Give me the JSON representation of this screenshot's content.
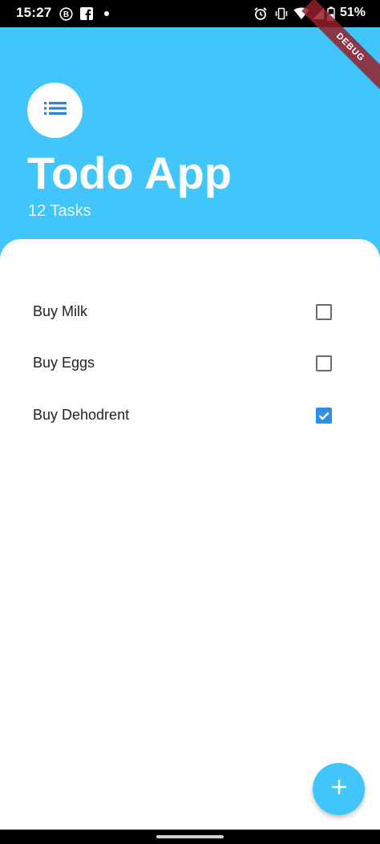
{
  "status_bar": {
    "time": "15:27",
    "battery_text": "51%",
    "icons": [
      "b-badge-icon",
      "facebook-icon",
      "dot-icon",
      "alarm-icon",
      "vibrate-icon",
      "wifi-icon",
      "signal-icon",
      "battery-icon"
    ]
  },
  "debug_banner": "DEBUG",
  "header": {
    "icon": "list-icon",
    "title": "Todo App",
    "task_count": "12 Tasks"
  },
  "todos": [
    {
      "label": "Buy Milk",
      "checked": false
    },
    {
      "label": "Buy Eggs",
      "checked": false
    },
    {
      "label": "Buy Dehodrent",
      "checked": true
    }
  ],
  "fab": {
    "icon": "plus-icon"
  },
  "colors": {
    "primary": "#42c5fb",
    "checkbox_checked": "#2d8fe6",
    "list_icon": "#2d7fd8"
  }
}
